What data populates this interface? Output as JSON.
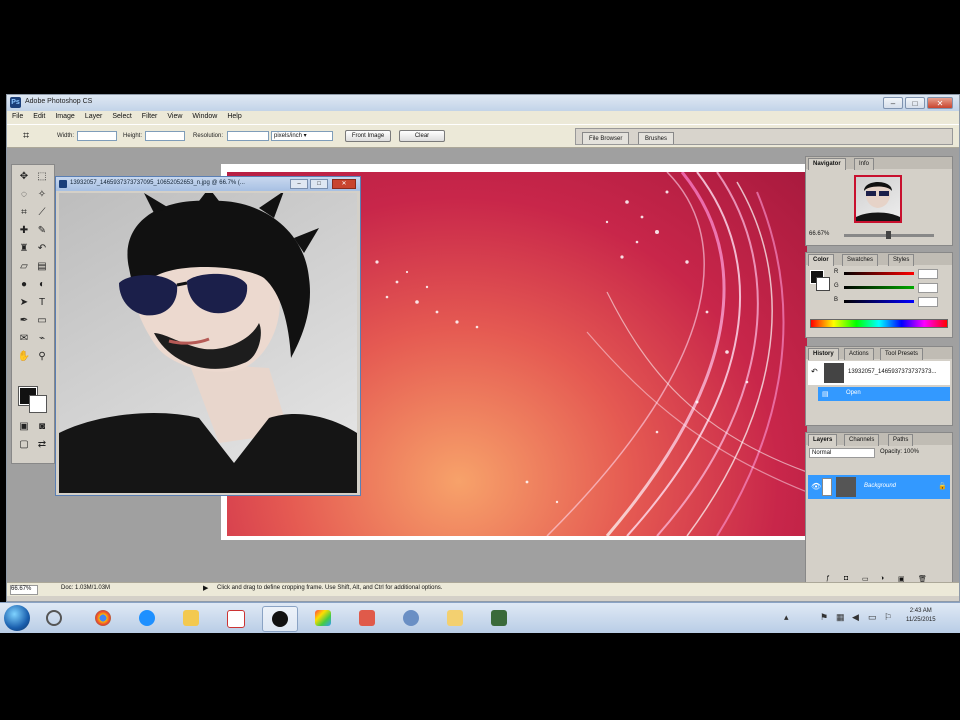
{
  "app": {
    "title": "Adobe Photoshop CS",
    "icon_name": "photoshop-icon",
    "controls": {
      "minimize": "–",
      "maximize": "□",
      "close": "✕"
    }
  },
  "menu": [
    "File",
    "Edit",
    "Image",
    "Layer",
    "Select",
    "Filter",
    "View",
    "Window",
    "Help"
  ],
  "options_bar": {
    "tool_icon": "crop-tool-icon",
    "width_label": "Width:",
    "height_label": "Height:",
    "resolution_label": "Resolution:",
    "units_value": "pixels/inch",
    "front_image_button": "Front Image",
    "clear_button": "Clear",
    "well_tabs": [
      "File Browser",
      "Brushes"
    ]
  },
  "documents": {
    "photo_title": "13932057_1465937373737095_10652052653_n.jpg @ 66.7% (...",
    "background_doc": "pink-red light streak background"
  },
  "panels": {
    "navigator": {
      "tabs": [
        "Navigator",
        "Info"
      ],
      "zoom": "66.67%"
    },
    "color": {
      "tabs": [
        "Color",
        "Swatches",
        "Styles"
      ],
      "channels": [
        "R",
        "G",
        "B"
      ]
    },
    "history": {
      "tabs": [
        "History",
        "Actions",
        "Tool Presets"
      ],
      "items": [
        "13932057_1465937373737373...",
        "Open"
      ]
    },
    "layers": {
      "tabs": [
        "Layers",
        "Channels",
        "Paths"
      ],
      "blend_mode": "Normal",
      "opacity": "Opacity: 100%",
      "layer_name": "Background"
    }
  },
  "status_bar": {
    "zoom": "66.67%",
    "doc_info": "Doc: 1.03M/1.03M",
    "hint": "Click and drag to define cropping frame. Use Shift, Alt, and Ctrl for additional options."
  },
  "taskbar": {
    "apps": [
      "chrome-icon",
      "ie-icon",
      "folder-icon",
      "calendar-icon",
      "media-player-icon",
      "photoshop-icon",
      "paint-icon",
      "network-icon",
      "folder-icon",
      "game-icon"
    ],
    "clock_time": "2:43 AM",
    "clock_date": "11/25/2015"
  },
  "colors": {
    "accent": "#3399ff",
    "title_bar": "#c2d3e8",
    "chrome": "#d4d0c8"
  }
}
